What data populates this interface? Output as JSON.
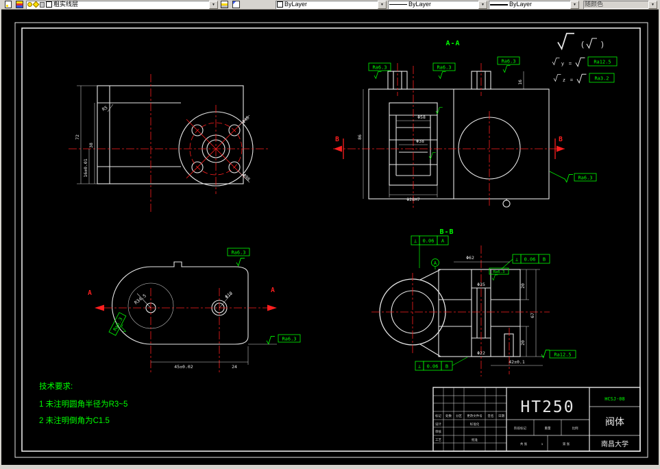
{
  "toolbar": {
    "layer_name": "粗实线层",
    "color_value": "ByLayer",
    "linetype_value": "ByLayer",
    "lineweight_value": "ByLayer",
    "plot_style_value": "随颜色"
  },
  "legend": {
    "paren_open": "(",
    "paren_close": ")",
    "row1_var": "y",
    "row1_eq": "=",
    "row1_ra": "Ra12.5",
    "row2_var": "z",
    "row2_eq": "=",
    "row2_ra": "Ra3.2"
  },
  "front_view": {
    "dim_height": "72",
    "dim_width": "38",
    "dim_tol": "16±0.01",
    "dim_r5": "R5",
    "dim_bolt": "Φ48",
    "dim_flange": "Φ98"
  },
  "section_aa": {
    "label": "A-A",
    "cut_letter": "B",
    "dim_86": "86",
    "dim_16": "16",
    "dim_d58": "Φ58",
    "dim_d38": "Φ38",
    "dim_bore": "Φ28H7",
    "ra_1": "Ra6.3",
    "ra_2": "Ra6.3",
    "ra_3": "Ra6.3",
    "ra_4": "Ra6.3"
  },
  "bottom_view": {
    "cut_letter": "A",
    "dim_r345": "R34.5",
    "dim_d10": "Φ10",
    "dim_45": "45±0.02",
    "dim_24": "24",
    "ra_top": "Ra6.3",
    "ra_left": "Ra6.3",
    "ra_right": "Ra6.3"
  },
  "section_bb": {
    "label": "B-B",
    "fcf_top": {
      "sym": "⊥",
      "tol": "0.06",
      "datum": "A"
    },
    "fcf_right": {
      "sym": "⊥",
      "tol": "0.06",
      "datum": "B"
    },
    "fcf_bottom": {
      "sym": "⊥",
      "tol": "0.06",
      "datum": "B"
    },
    "datum_a": "A",
    "dim_d62": "Φ62",
    "dim_d35": "Φ35",
    "dim_20a": "20",
    "dim_67": "67",
    "dim_20b": "20",
    "dim_d22": "Φ22",
    "dim_42": "42±0.1",
    "ra_125": "Ra12.5",
    "ra_63": "Ra6.3"
  },
  "tech_req": {
    "title": "技术要求:",
    "line1": "1 未注明圆角半径为R3~5",
    "line2": "2 未注明倒角为C1.5"
  },
  "title_block": {
    "material": "HT250",
    "drawing_no": "HCSJ-08",
    "part_name": "阀体",
    "company": "南昌大学",
    "col_mark": "标记",
    "col_count": "处数",
    "col_zone": "分区",
    "col_file": "更改文件号",
    "col_sign": "签名",
    "col_date": "日期",
    "row_design": "设计",
    "row_check": "审核",
    "row_process": "工艺",
    "row_approve": "批准",
    "row_std": "标准化",
    "stage": "阶段标记",
    "weight": "重量",
    "scale": "比例",
    "sheet": "共 张",
    "sheet_no": "1",
    "page": "第 张"
  }
}
